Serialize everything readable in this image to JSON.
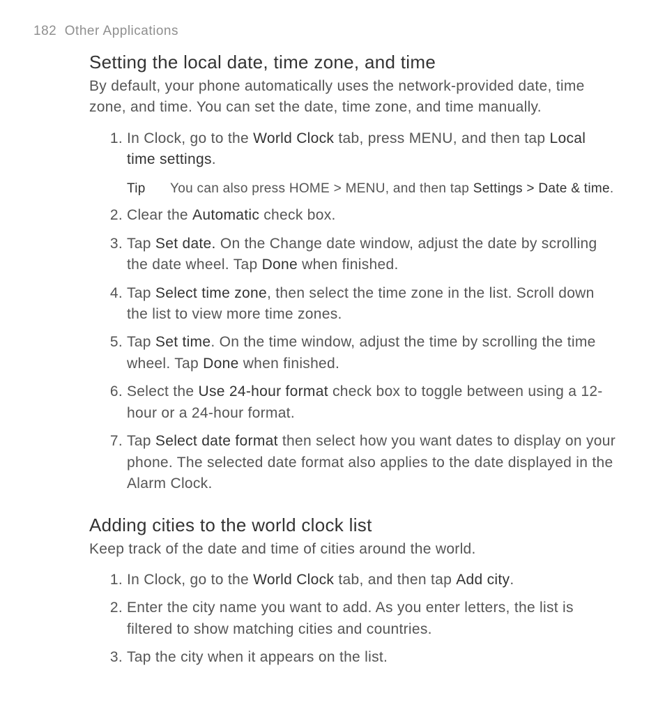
{
  "header": {
    "page_number": "182",
    "chapter": "Other Applications"
  },
  "section1": {
    "title": "Setting the local date, time zone, and time",
    "lead": "By default, your phone automatically uses the network-provided date, time zone, and time. You can set the date, time zone, and time manually.",
    "steps": {
      "s1_a": "In Clock, go to the ",
      "s1_b": "World Clock",
      "s1_c": " tab, press MENU, and then tap ",
      "s1_d": "Local time settings",
      "s1_e": ".",
      "tip_label": "Tip",
      "tip_a": "You can also press HOME > MENU, and then tap ",
      "tip_b": "Settings > Date & time",
      "tip_c": ".",
      "s2_a": "Clear the ",
      "s2_b": "Automatic",
      "s2_c": " check box.",
      "s3_a": "Tap ",
      "s3_b": "Set date",
      "s3_c": ".",
      "s3_d": " On the Change date window, adjust the date by scrolling the date wheel. Tap ",
      "s3_e": "Done",
      "s3_f": " when finished.",
      "s4_a": "Tap ",
      "s4_b": "Select time zone",
      "s4_c": ", then select the time zone in the list. Scroll down the list to view more time zones.",
      "s5_a": "Tap ",
      "s5_b": "Set time",
      "s5_c": ". On the time window, adjust the time by scrolling the time wheel. Tap ",
      "s5_d": "Done",
      "s5_e": " when finished.",
      "s6_a": "Select the ",
      "s6_b": "Use 24-hour format",
      "s6_c": " check box to toggle between using a 12-hour or a 24-hour format.",
      "s7_a": "Tap ",
      "s7_b": "Select date format",
      "s7_c": " then select how you want dates to display on your phone. The selected date format also applies to the date displayed in the Alarm Clock."
    }
  },
  "section2": {
    "title": "Adding cities to the world clock list",
    "lead": "Keep track of the date and time of cities around the world.",
    "steps": {
      "s1_a": "In Clock, go to the ",
      "s1_b": "World Clock",
      "s1_c": " tab, and then tap ",
      "s1_d": "Add city",
      "s1_e": ".",
      "s2": "Enter the city name you want to add. As you enter letters, the list is filtered to show matching cities and countries.",
      "s3": "Tap the city when it appears on the list."
    }
  }
}
